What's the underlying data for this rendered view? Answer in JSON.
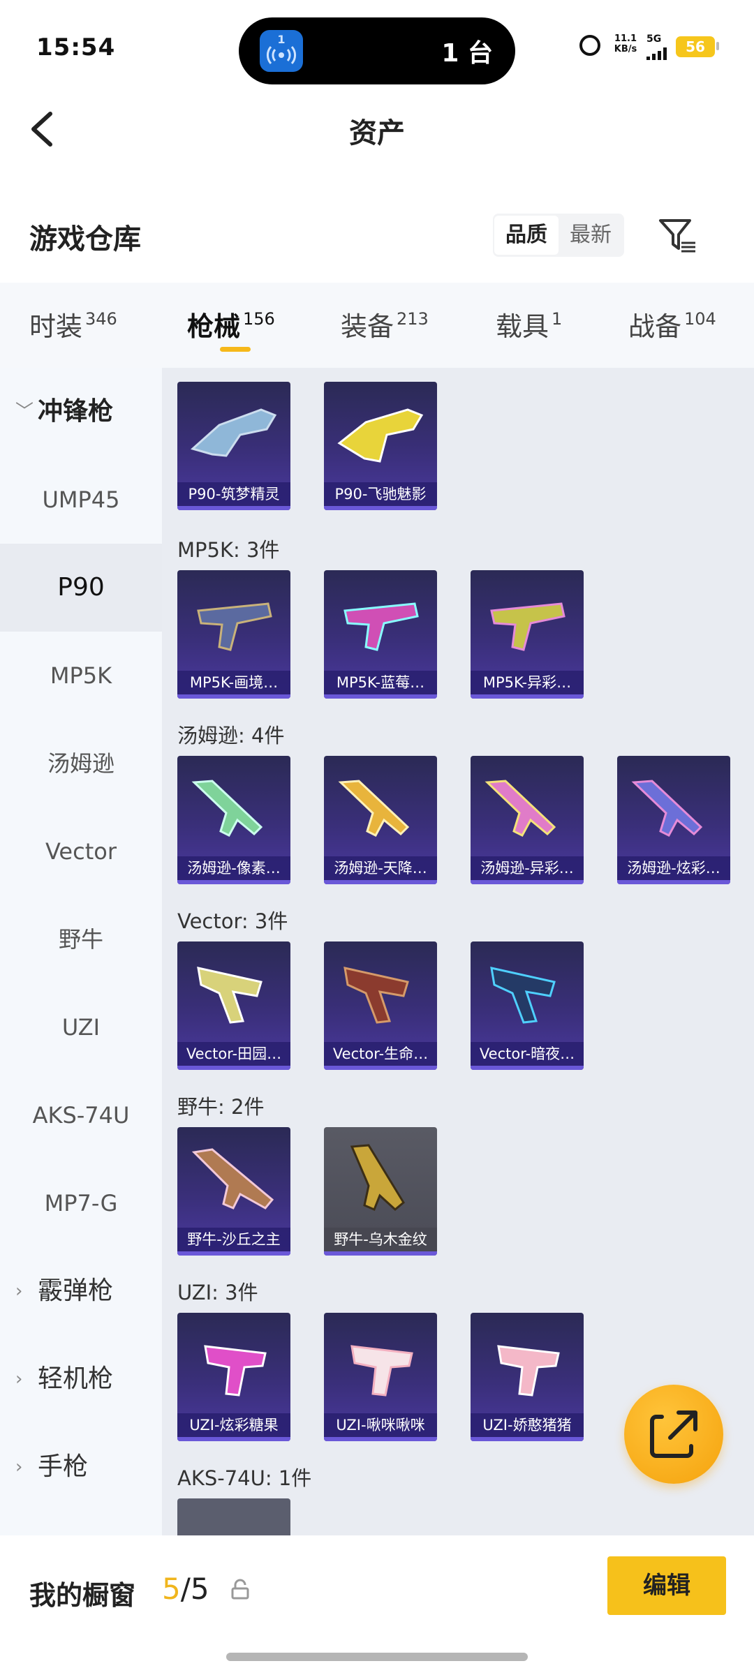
{
  "status_bar": {
    "time": "15:54",
    "island_badge": "1",
    "island_text": "1 台",
    "speed_value": "11.1",
    "speed_unit": "KB/s",
    "network": "5G",
    "battery": "56"
  },
  "header": {
    "title": "资产"
  },
  "warehouse": {
    "title": "游戏仓库",
    "sort_options": [
      "品质",
      "最新"
    ],
    "active_sort": "品质"
  },
  "tabs": [
    {
      "label": "时装",
      "count": "346"
    },
    {
      "label": "枪械",
      "count": "156",
      "active": true
    },
    {
      "label": "装备",
      "count": "213"
    },
    {
      "label": "载具",
      "count": "1"
    },
    {
      "label": "战备",
      "count": "104"
    }
  ],
  "sidebar": {
    "category_open": "冲锋枪",
    "items": [
      "UMP45",
      "P90",
      "MP5K",
      "汤姆逊",
      "Vector",
      "野牛",
      "UZI",
      "AKS-74U",
      "MP7-G"
    ],
    "selected": "P90",
    "categories_closed": [
      "霰弹枪",
      "轻机枪",
      "手枪"
    ]
  },
  "groups": [
    {
      "title": "",
      "items": [
        "P90-筑梦精灵",
        "P90-飞驰魅影"
      ]
    },
    {
      "title": "MP5K: 3件",
      "items": [
        "MP5K-画境…",
        "MP5K-蓝莓…",
        "MP5K-异彩…"
      ]
    },
    {
      "title": "汤姆逊: 4件",
      "items": [
        "汤姆逊-像素…",
        "汤姆逊-天降…",
        "汤姆逊-异彩…",
        "汤姆逊-炫彩…"
      ]
    },
    {
      "title": "Vector: 3件",
      "items": [
        "Vector-田园…",
        "Vector-生命…",
        "Vector-暗夜…"
      ]
    },
    {
      "title": "野牛: 2件",
      "items": [
        "野牛-沙丘之主",
        "野牛-乌木金纹"
      ]
    },
    {
      "title": "UZI: 3件",
      "items": [
        "UZI-炫彩糖果",
        "UZI-啾咪啾咪",
        "UZI-娇憨猪猪"
      ]
    },
    {
      "title": "AKS-74U: 1件",
      "items": []
    }
  ],
  "showcase": {
    "label": "我的橱窗",
    "current": "5",
    "total": "/5",
    "edit_label": "编辑"
  },
  "colors": {
    "accent": "#f6c11b",
    "card_bg": "#3a2f7a",
    "label_bg": "#281e6e"
  }
}
